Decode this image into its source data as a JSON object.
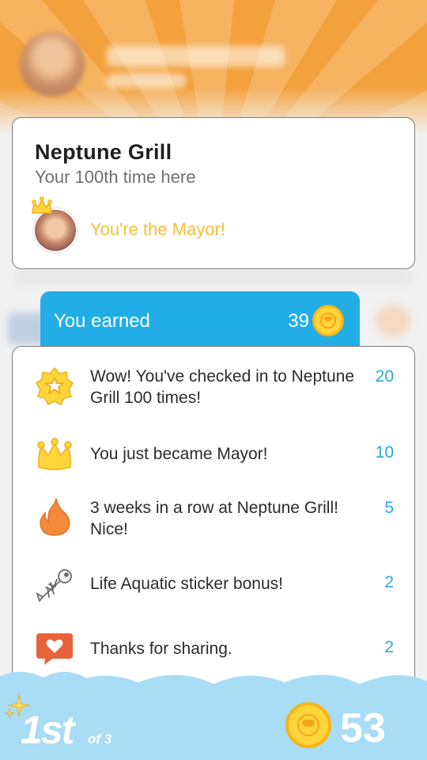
{
  "colors": {
    "orange": "#f3a13c",
    "blue": "#21aee6",
    "points_blue": "#2fa7d8",
    "mayor_yellow": "#f6be3a",
    "sky": "#a9dcf5"
  },
  "venue": {
    "name": "Neptune Grill",
    "visit_text": "Your 100th time here",
    "mayor_text": "You're the Mayor!"
  },
  "earned": {
    "label": "You earned",
    "value": "39",
    "icon": "coin-icon"
  },
  "rewards": [
    {
      "icon": "badge-star-icon",
      "text": "Wow! You've checked in to Neptune Grill 100 times!",
      "points": "20"
    },
    {
      "icon": "crown-icon",
      "text": "You just became Mayor!",
      "points": "10"
    },
    {
      "icon": "flame-icon",
      "text": "3 weeks in a row at Neptune Grill! Nice!",
      "points": "5"
    },
    {
      "icon": "fish-skeleton-sticker-icon",
      "text": "Life Aquatic sticker bonus!",
      "points": "2"
    },
    {
      "icon": "heart-speech-bubble-icon",
      "text": "Thanks for sharing.",
      "points": "2"
    }
  ],
  "leaderboard": {
    "rank": "1st",
    "of_text": "of 3",
    "total_coins": "53"
  }
}
